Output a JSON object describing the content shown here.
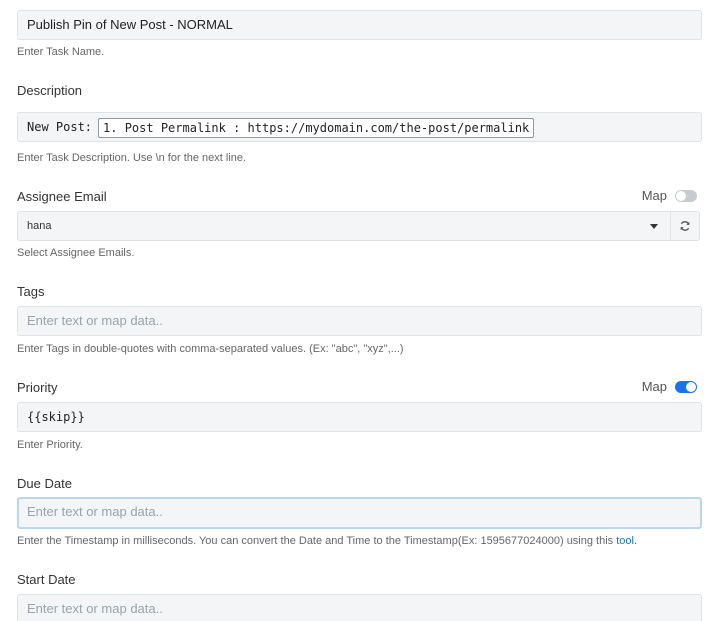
{
  "task_name": {
    "value": "Publish Pin of New Post - NORMAL",
    "help": "Enter Task Name."
  },
  "description": {
    "label": "Description",
    "prefix": "New Post:",
    "chip": "1. Post Permalink : https://mydomain.com/the-post/permalink",
    "help": "Enter Task Description. Use \\n for the next line."
  },
  "assignee": {
    "label": "Assignee Email",
    "map_label": "Map",
    "map_on": false,
    "value": "hana",
    "help": "Select Assignee Emails."
  },
  "tags": {
    "label": "Tags",
    "placeholder": "Enter text or map data..",
    "help": "Enter Tags in double-quotes with comma-separated values. (Ex: \"abc\", \"xyz\",...)"
  },
  "priority": {
    "label": "Priority",
    "map_label": "Map",
    "map_on": true,
    "value": "{{skip}}",
    "help": "Enter Priority."
  },
  "due_date": {
    "label": "Due Date",
    "placeholder": "Enter text or map data..",
    "help_prefix": "Enter the Timestamp in milliseconds. You can convert the Date and Time to the Timestamp(Ex: 1595677024000) using this ",
    "help_link": "tool",
    "help_suffix": "."
  },
  "start_date": {
    "label": "Start Date",
    "placeholder": "Enter text or map data.."
  },
  "icons": {
    "dropdown": "chevron-down-icon",
    "refresh": "refresh-icon"
  },
  "colors": {
    "accent": "#1a73e8",
    "link": "#1a73c9"
  }
}
